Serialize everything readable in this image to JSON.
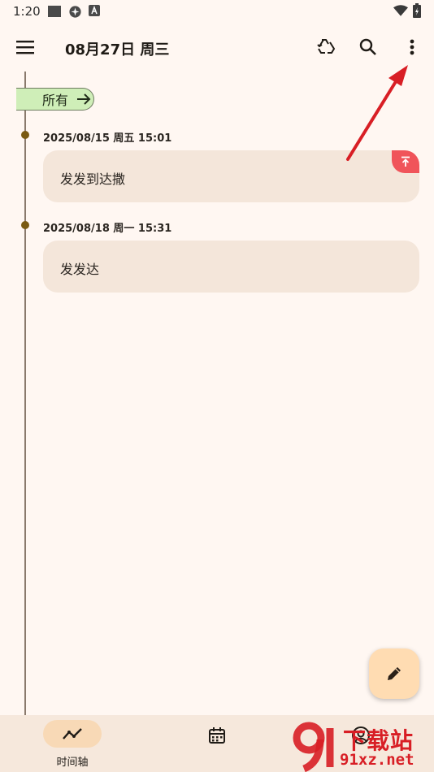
{
  "status_bar": {
    "time": "1:20"
  },
  "app_bar": {
    "title": "08月27日 周三"
  },
  "filter": {
    "label": "所有"
  },
  "entries": [
    {
      "date": "2025/08/15 周五 15:01",
      "text": "发发到达撒",
      "pinned": true
    },
    {
      "date": "2025/08/18 周一 15:31",
      "text": "发发达",
      "pinned": false
    }
  ],
  "bottom_nav": {
    "timeline_label": "时间轴"
  },
  "watermark": {
    "cn": "下载站",
    "en": "91xz.net"
  },
  "colors": {
    "accent": "#f8d9b6",
    "chip": "#cfeeb8",
    "card": "#f4e6da",
    "pin": "#f0545a",
    "annotation": "#d81e25"
  }
}
